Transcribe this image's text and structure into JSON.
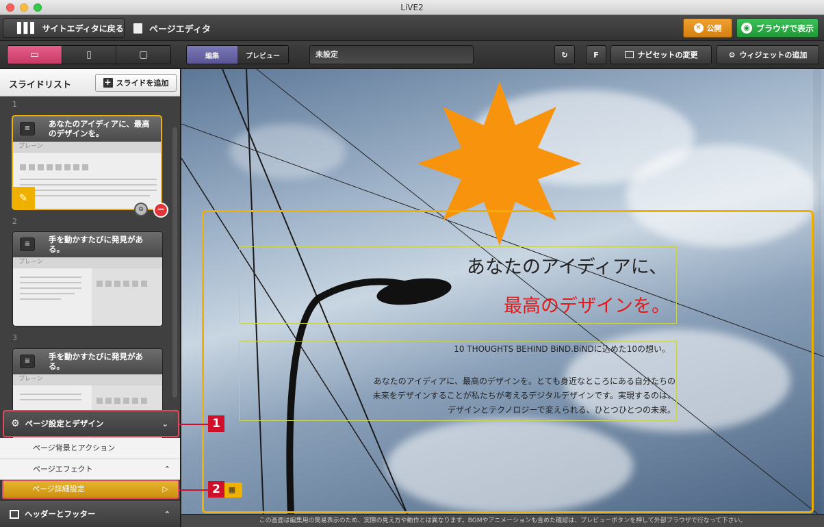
{
  "window": {
    "title": "LiVE2"
  },
  "toolbar": {
    "back_label": "サイトエディタに戻る",
    "page_title": "ページエディタ",
    "publish_label": "公開",
    "browser_label": "ブラウザで表示"
  },
  "toolbar2": {
    "edit_label": "編集",
    "preview_label": "プレビュー",
    "status_text": "未設定",
    "f_label": "F",
    "naviset_label": "ナビセットの変更",
    "widget_label": "ウィジェットの追加"
  },
  "sidebar": {
    "title": "スライドリスト",
    "add_slide_label": "スライドを追加",
    "slides": [
      {
        "num": "1",
        "title": "あなたのアイディアに、最高のデザインを。",
        "layout": "プレーン"
      },
      {
        "num": "2",
        "title": "手を動かすたびに発見がある。",
        "layout": "プレーン"
      },
      {
        "num": "3",
        "title": "手を動かすたびに発見がある。",
        "layout": "プレーン"
      }
    ],
    "accordion": {
      "page_settings": "ページ設定とデザイン",
      "bg_action": "ページ背景とアクション",
      "effect": "ページエフェクト",
      "detail": "ページ詳細設定",
      "header_footer": "ヘッダーとフッター"
    }
  },
  "canvas": {
    "heading1": "あなたのアイディアに、",
    "heading2": "最高のデザインを。",
    "subhead": "10 THOUGHTS BEHIND BiND.BiNDに込めた10の想い。",
    "body1": "あなたのアイディアに、最高のデザインを。とても身近なところにある自分たちの",
    "body2": "未来をデザインすることが私たちが考えるデジタルデザインです。実現するのは、",
    "body3": "デザインとテクノロジーで変えられる、ひとつひとつの未来。"
  },
  "footer": {
    "note": "この画面は編集用の簡易表示のため、実際の見え方や動作とは異なります。BGMやアニメーションも含めた確認は、プレビューボタンを押して外部ブラウザで行なって下さい。"
  },
  "callouts": {
    "one": "1",
    "two": "2"
  },
  "colors": {
    "accent_pink": "#d94c7a",
    "publish_orange": "#e8941a",
    "browser_green": "#2fb04b",
    "selection_yellow": "#f0b000",
    "callout_red": "#d0102a",
    "headline_red": "#e31b1b",
    "star_orange": "#f7930d"
  }
}
